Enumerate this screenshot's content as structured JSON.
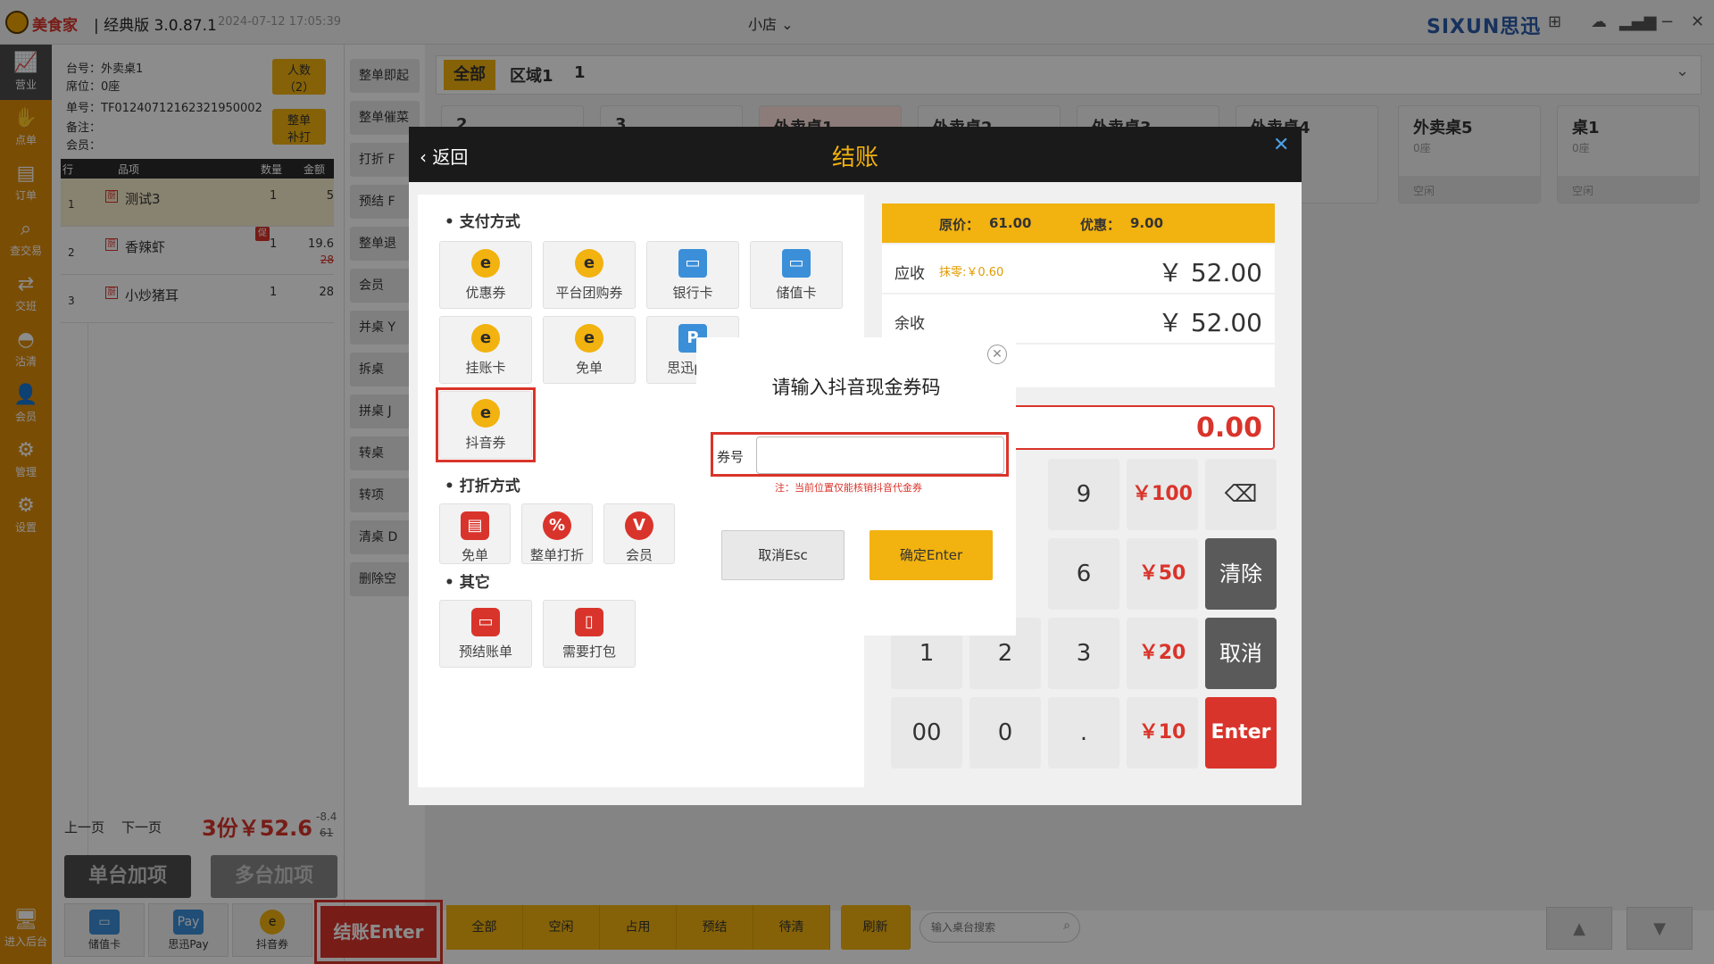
{
  "titlebar": {
    "brand": "美食家",
    "edition": "| 经典版 3.0.87.1",
    "timestamp": "2024-07-12 17:05:39",
    "store": "小店",
    "store_chevron": "chevron-down",
    "vendor": "SIXUN思迅"
  },
  "sidenav": {
    "items": [
      {
        "label": "营业",
        "icon": "chart-icon"
      },
      {
        "label": "点单",
        "icon": "hand-icon"
      },
      {
        "label": "订单",
        "icon": "doc-icon"
      },
      {
        "label": "查交易",
        "icon": "search-icon"
      },
      {
        "label": "交班",
        "icon": "swap-icon"
      },
      {
        "label": "沽清",
        "icon": "cloche-icon"
      },
      {
        "label": "会员",
        "icon": "user-icon"
      },
      {
        "label": "管理",
        "icon": "manage-icon"
      },
      {
        "label": "设置",
        "icon": "gear-icon"
      },
      {
        "label": "进入后台",
        "icon": "monitor-icon"
      }
    ]
  },
  "order": {
    "table_label": "台号：外卖桌1",
    "seat_label": "席位：0座",
    "order_no_label": "单号：TF01240712162321950002",
    "remark_label": "备注：",
    "member_label": "会员：",
    "people_btn": "人数\n（2）",
    "reprint_btn": "整单\n补打",
    "columns": [
      "行",
      "品项",
      "数量",
      "金额"
    ],
    "rows": [
      {
        "no": "1",
        "badge": "厨",
        "name": "测试3",
        "qty": "1",
        "amount": "5",
        "promo": "",
        "orig": ""
      },
      {
        "no": "2",
        "badge": "厨",
        "name": "香辣虾",
        "qty": "1",
        "amount": "19.6",
        "promo": "促",
        "orig": "28"
      },
      {
        "no": "3",
        "badge": "厨",
        "name": "小炒猪耳",
        "qty": "1",
        "amount": "28",
        "promo": "",
        "orig": ""
      }
    ],
    "prev": "上一页",
    "next": "下一页",
    "total": "3份￥52.6",
    "discount": "-8.4",
    "orig_total": "61",
    "single_add": "单台加项",
    "multi_add": "多台加项"
  },
  "midbuttons": [
    "整单即起",
    "整单催菜",
    "打折 F",
    "预结 F",
    "整单退",
    "会员",
    "并桌 Y",
    "拆桌",
    "拼桌 J",
    "转桌",
    "转项",
    "清桌 D",
    "删除空"
  ],
  "tables": {
    "tabs": [
      "全部",
      "区域1",
      "1"
    ],
    "cards": [
      {
        "name": "2",
        "seats": "",
        "status": ""
      },
      {
        "name": "3",
        "seats": "",
        "status": ""
      },
      {
        "name": "外卖桌1",
        "seats": "",
        "status": ""
      },
      {
        "name": "外卖桌2",
        "seats": "",
        "status": ""
      },
      {
        "name": "外卖桌3",
        "seats": "",
        "status": ""
      },
      {
        "name": "外卖桌4",
        "seats": "",
        "status": ""
      },
      {
        "name": "外卖桌5",
        "seats": "0座",
        "status": "空闲"
      },
      {
        "name": "桌1",
        "seats": "0座",
        "status": "空闲"
      }
    ]
  },
  "checkout": {
    "back": "返回",
    "title": "结账",
    "pay_section": "支付方式",
    "discount_section": "打折方式",
    "other_section": "其它",
    "pay_methods": [
      "优惠券",
      "平台团购券",
      "银行卡",
      "储值卡",
      "挂账卡",
      "免单",
      "思迅pay",
      "抖音券"
    ],
    "discount_methods": [
      "免单",
      "整单打折",
      "会员"
    ],
    "others": [
      "预结账单",
      "需要打包"
    ],
    "orig_price_label": "原价：",
    "orig_price": "61.00",
    "discount_label": "优惠：",
    "discount": "9.00",
    "receivable_label": "应收",
    "rounding": "抹零:￥0.60",
    "receivable": "￥ 52.00",
    "balance_label": "余收",
    "balance": "￥ 52.00",
    "input_amount": "0.00",
    "keys": [
      "9",
      "￥100",
      "6",
      "￥50",
      "清除",
      "1",
      "2",
      "3",
      "￥20",
      "取消",
      "00",
      "0",
      ".",
      "￥10",
      "Enter"
    ]
  },
  "dialog": {
    "title": "请输入抖音现金券码",
    "code_label": "券号",
    "code_value": "",
    "note": "注：当前位置仅能核销抖音代金券",
    "cancel": "取消Esc",
    "confirm": "确定Enter"
  },
  "bottom": {
    "icons": [
      "储值卡",
      "思迅Pay",
      "抖音券"
    ],
    "checkout": "结账Enter",
    "filters": [
      "全部",
      "空闲",
      "占用",
      "预结",
      "待清"
    ],
    "refresh": "刷新",
    "search_placeholder": "输入桌台搜索"
  },
  "colors": {
    "accent": "#f2b20f",
    "nav": "#de8c0a",
    "danger": "#d9342b"
  }
}
